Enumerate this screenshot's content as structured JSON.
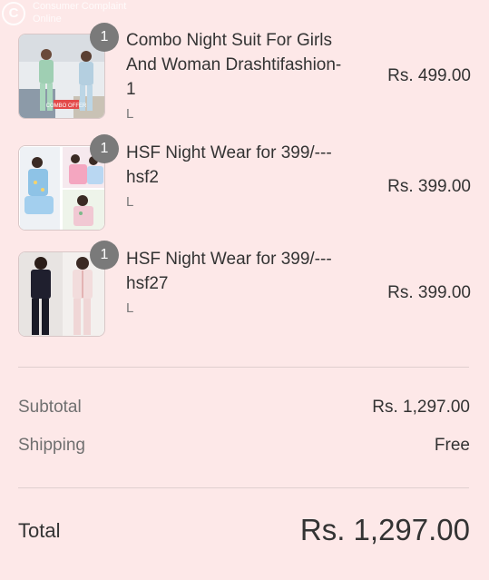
{
  "watermark": {
    "line1": "Consumer Complaint",
    "line2": "Online"
  },
  "items": [
    {
      "qty": "1",
      "title": "Combo Night Suit For Girls And Woman Drashtifashion-1",
      "variant": "L",
      "price": "Rs. 499.00",
      "thumb_label": "COMBO OFFER"
    },
    {
      "qty": "1",
      "title": "HSF Night Wear for 399/--- hsf2",
      "variant": "L",
      "price": "Rs. 399.00"
    },
    {
      "qty": "1",
      "title": "HSF Night Wear for 399/--- hsf27",
      "variant": "L",
      "price": "Rs. 399.00"
    }
  ],
  "summary": {
    "subtotal_label": "Subtotal",
    "subtotal_value": "Rs. 1,297.00",
    "shipping_label": "Shipping",
    "shipping_value": "Free",
    "total_label": "Total",
    "total_value": "Rs. 1,297.00"
  }
}
